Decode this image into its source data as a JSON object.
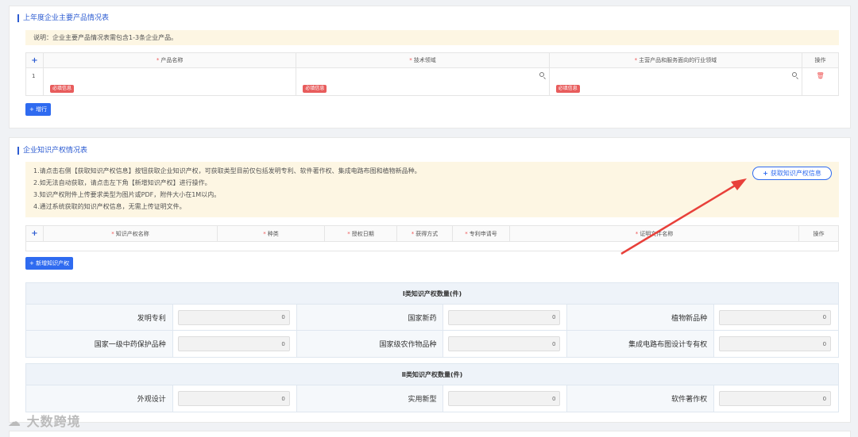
{
  "products_section": {
    "title": "上年度企业主要产品情况表",
    "notice": "说明：企业主要产品情况表需包含1-3条企业产品。",
    "columns": [
      "+",
      "* 产品名称",
      "* 技术领域",
      "* 主营产品和服务面向的行业领域",
      "操作"
    ],
    "rows": [
      {
        "index": "1",
        "required_tag": "必填信息"
      }
    ],
    "add_row_label": "+ 增行"
  },
  "ip_section": {
    "title": "企业知识产权情况表",
    "notices": [
      "1.请点击右侧【获取知识产权信息】按钮获取企业知识产权，可获取类型目前仅包括发明专利、软件著作权、集成电路布图和植物新品种。",
      "2.如无法自动获取，请点击左下角【新增知识产权】进行操作。",
      "3.知识产权附件上传要求类型为图片或PDF，附件大小在1M以内。",
      "4.通过系统获取的知识产权信息，无需上传证明文件。"
    ],
    "fetch_button": "获取知识产权信息",
    "columns": [
      "+",
      "* 知识产权名称",
      "* 种类",
      "* 授权日期",
      "* 获得方式",
      "* 专利申请号",
      "* 证明文件名称",
      "操作"
    ],
    "add_button": "+ 新增知识产权"
  },
  "class1": {
    "title": "Ⅰ类知识产权数量(件)",
    "rows": [
      [
        {
          "label": "发明专利",
          "value": "0"
        },
        {
          "label": "国家新药",
          "value": "0"
        },
        {
          "label": "植物新品种",
          "value": "0"
        }
      ],
      [
        {
          "label": "国家一级中药保护品种",
          "value": "0"
        },
        {
          "label": "国家级农作物品种",
          "value": "0"
        },
        {
          "label": "集成电路布图设计专有权",
          "value": "0"
        }
      ]
    ]
  },
  "class2": {
    "title": "Ⅱ类知识产权数量(件)",
    "rows": [
      [
        {
          "label": "外观设计",
          "value": "0"
        },
        {
          "label": "实用新型",
          "value": "0"
        },
        {
          "label": "软件著作权",
          "value": "0"
        }
      ]
    ]
  },
  "watermark": "大数跨境",
  "colors": {
    "accent": "#2f6bf0",
    "required": "#e55555",
    "notice_bg": "#fdf6e3",
    "arrow": "#e8403a"
  }
}
